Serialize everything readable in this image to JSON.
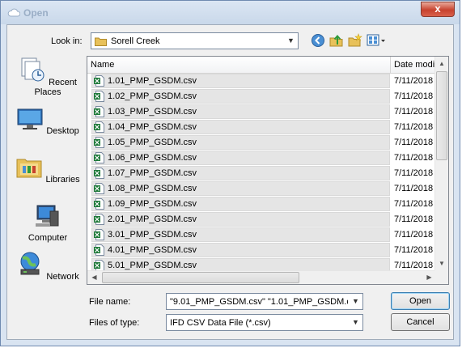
{
  "window": {
    "title": "Open",
    "close_label": "x"
  },
  "lookin": {
    "label": "Look in:",
    "value": "Sorell Creek"
  },
  "toolbar": {
    "back": "back-icon",
    "up": "up-folder-icon",
    "new_folder": "new-folder-icon",
    "views": "views-icon"
  },
  "places": [
    {
      "label": "Recent Places",
      "icon": "recent-places-icon"
    },
    {
      "label": "Desktop",
      "icon": "desktop-icon"
    },
    {
      "label": "Libraries",
      "icon": "libraries-icon"
    },
    {
      "label": "Computer",
      "icon": "computer-icon"
    },
    {
      "label": "Network",
      "icon": "network-icon"
    }
  ],
  "list": {
    "columns": {
      "name": "Name",
      "date": "Date modifi"
    },
    "files": [
      {
        "name": "1.01_PMP_GSDM.csv",
        "date": "7/11/2018"
      },
      {
        "name": "1.02_PMP_GSDM.csv",
        "date": "7/11/2018"
      },
      {
        "name": "1.03_PMP_GSDM.csv",
        "date": "7/11/2018"
      },
      {
        "name": "1.04_PMP_GSDM.csv",
        "date": "7/11/2018"
      },
      {
        "name": "1.05_PMP_GSDM.csv",
        "date": "7/11/2018"
      },
      {
        "name": "1.06_PMP_GSDM.csv",
        "date": "7/11/2018"
      },
      {
        "name": "1.07_PMP_GSDM.csv",
        "date": "7/11/2018"
      },
      {
        "name": "1.08_PMP_GSDM.csv",
        "date": "7/11/2018"
      },
      {
        "name": "1.09_PMP_GSDM.csv",
        "date": "7/11/2018"
      },
      {
        "name": "2.01_PMP_GSDM.csv",
        "date": "7/11/2018"
      },
      {
        "name": "3.01_PMP_GSDM.csv",
        "date": "7/11/2018"
      },
      {
        "name": "4.01_PMP_GSDM.csv",
        "date": "7/11/2018"
      },
      {
        "name": "5.01_PMP_GSDM.csv",
        "date": "7/11/2018"
      }
    ]
  },
  "filename": {
    "label": "File name:",
    "value": "\"9.01_PMP_GSDM.csv\" \"1.01_PMP_GSDM.c"
  },
  "filetype": {
    "label": "Files of type:",
    "value": "IFD CSV Data File (*.csv)"
  },
  "buttons": {
    "open": "Open",
    "cancel": "Cancel"
  },
  "colors": {
    "accent": "#3c7fb1",
    "excel_green": "#1f7a3a",
    "folder": "#e8c15a"
  }
}
